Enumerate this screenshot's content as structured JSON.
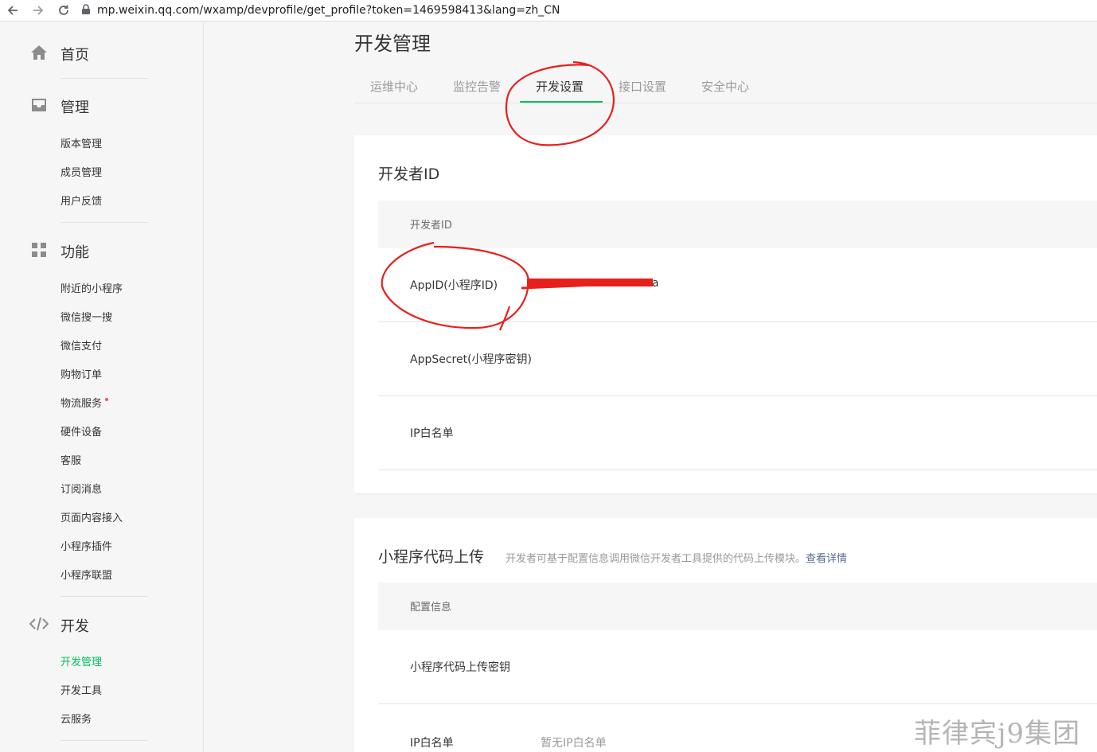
{
  "browser": {
    "url": "mp.weixin.qq.com/wxamp/devprofile/get_profile?token=1469598413&lang=zh_CN"
  },
  "sidebar": {
    "home": "首页",
    "manage": {
      "label": "管理",
      "items": [
        "版本管理",
        "成员管理",
        "用户反馈"
      ]
    },
    "features": {
      "label": "功能",
      "items": [
        "附近的小程序",
        "微信搜一搜",
        "微信支付",
        "购物订单",
        "物流服务",
        "硬件设备",
        "客服",
        "订阅消息",
        "页面内容接入",
        "小程序插件",
        "小程序联盟"
      ]
    },
    "develop": {
      "label": "开发",
      "items": [
        "开发管理",
        "开发工具",
        "云服务"
      ]
    }
  },
  "main": {
    "title": "开发管理",
    "tabs": [
      "运维中心",
      "监控告警",
      "开发设置",
      "接口设置",
      "安全中心"
    ],
    "developer_card": {
      "title": "开发者ID",
      "header": "开发者ID",
      "rows": {
        "appid": "AppID(小程序ID)",
        "appid_value": "a",
        "appsecret": "AppSecret(小程序密钥)",
        "ip_whitelist": "IP白名单"
      }
    },
    "upload_card": {
      "title": "小程序代码上传",
      "desc": "开发者可基于配置信息调用微信开发者工具提供的代码上传模块。",
      "link": "查看详情",
      "header": "配置信息",
      "rows": {
        "upload_key": "小程序代码上传密钥",
        "ip_whitelist": "IP白名单",
        "ip_whitelist_value": "暂无IP白名单"
      }
    }
  },
  "watermark": "菲律宾j9集团",
  "colors": {
    "accent": "#07c160",
    "annotation": "#e8201c",
    "link": "#576b95"
  }
}
